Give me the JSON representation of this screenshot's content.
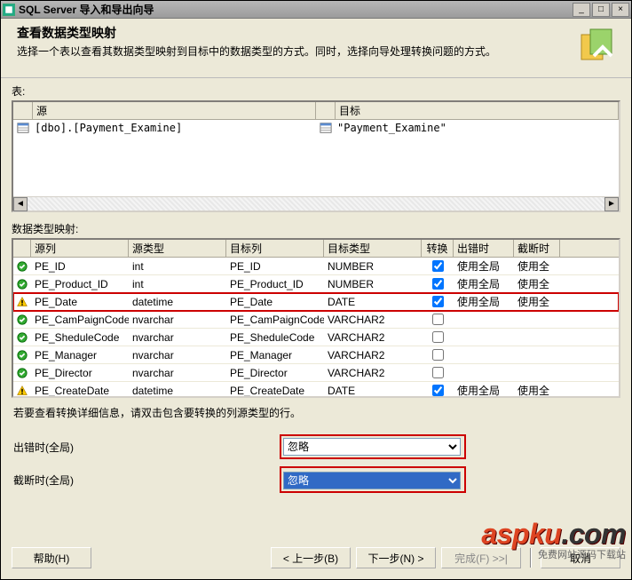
{
  "window": {
    "title": "SQL Server 导入和导出向导",
    "min_label": "_",
    "max_label": "□",
    "close_label": "×"
  },
  "header": {
    "title": "查看数据类型映射",
    "subtitle": "选择一个表以查看其数据类型映射到目标中的数据类型的方式。同时，选择向导处理转换问题的方式。"
  },
  "tables": {
    "label": "表:",
    "cols": {
      "src": "源",
      "dst": "目标"
    },
    "rows": [
      {
        "src": "[dbo].[Payment_Examine]",
        "dst": "\"Payment_Examine\""
      }
    ]
  },
  "mapping": {
    "label": "数据类型映射:",
    "cols": {
      "src_col": "源列",
      "src_type": "源类型",
      "dst_col": "目标列",
      "dst_type": "目标类型",
      "convert": "转换",
      "on_error": "出错时",
      "on_trunc": "截断时"
    },
    "rows": [
      {
        "status": "ok",
        "src": "PE_ID",
        "stype": "int",
        "dst": "PE_ID",
        "dtype": "NUMBER",
        "conv": true,
        "err": "使用全局",
        "trunc": "使用全"
      },
      {
        "status": "ok",
        "src": "PE_Product_ID",
        "stype": "int",
        "dst": "PE_Product_ID",
        "dtype": "NUMBER",
        "conv": true,
        "err": "使用全局",
        "trunc": "使用全"
      },
      {
        "status": "warn",
        "src": "PE_Date",
        "stype": "datetime",
        "dst": "PE_Date",
        "dtype": "DATE",
        "conv": true,
        "err": "使用全局",
        "trunc": "使用全",
        "highlight": true
      },
      {
        "status": "ok",
        "src": "PE_CamPaignCode",
        "stype": "nvarchar",
        "dst": "PE_CamPaignCode",
        "dtype": "VARCHAR2",
        "conv": false,
        "err": "",
        "trunc": ""
      },
      {
        "status": "ok",
        "src": "PE_SheduleCode",
        "stype": "nvarchar",
        "dst": "PE_SheduleCode",
        "dtype": "VARCHAR2",
        "conv": false,
        "err": "",
        "trunc": ""
      },
      {
        "status": "ok",
        "src": "PE_Manager",
        "stype": "nvarchar",
        "dst": "PE_Manager",
        "dtype": "VARCHAR2",
        "conv": false,
        "err": "",
        "trunc": ""
      },
      {
        "status": "ok",
        "src": "PE_Director",
        "stype": "nvarchar",
        "dst": "PE_Director",
        "dtype": "VARCHAR2",
        "conv": false,
        "err": "",
        "trunc": ""
      },
      {
        "status": "warn",
        "src": "PE_CreateDate",
        "stype": "datetime",
        "dst": "PE_CreateDate",
        "dtype": "DATE",
        "conv": true,
        "err": "使用全局",
        "trunc": "使用全"
      }
    ],
    "hint": "若要查看转换详细信息，请双击包含要转换的列源类型的行。"
  },
  "globals": {
    "error_label": "出错时(全局)",
    "trunc_label": "截断时(全局)",
    "option": "忽略"
  },
  "footer": {
    "help": "帮助(H)",
    "back": "< 上一步(B)",
    "next": "下一步(N) >",
    "finish": "完成(F) >>|",
    "cancel": "取消"
  },
  "watermark": {
    "brand": "aspku",
    "suffix": ".com",
    "tagline": "免费网站源码下载站"
  }
}
